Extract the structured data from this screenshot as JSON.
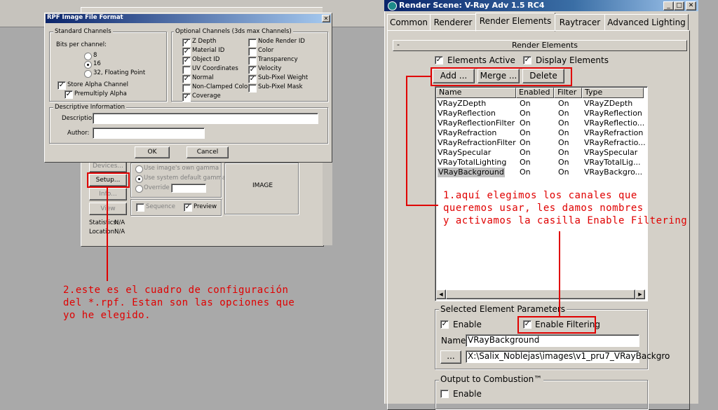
{
  "rpf_dialog": {
    "title": "RPF Image File Format",
    "standard_channels": {
      "title": "Standard Channels",
      "bits_label": "Bits per channel:",
      "opt8": "8",
      "opt16": "16",
      "opt32": "32, Floating Point",
      "store_alpha": "Store Alpha Channel",
      "premultiply": "Premultiply Alpha"
    },
    "optional_channels": {
      "title": "Optional Channels (3ds max Channels)",
      "col1": [
        "Z Depth",
        "Material ID",
        "Object ID",
        "UV Coordinates",
        "Normal",
        "Non-Clamped Color",
        "Coverage"
      ],
      "col1_checked": [
        true,
        true,
        true,
        false,
        true,
        false,
        true
      ],
      "col2": [
        "Node Render ID",
        "Color",
        "Transparency",
        "Velocity",
        "Sub-Pixel Weight",
        "Sub-Pixel Mask"
      ],
      "col2_checked": [
        false,
        false,
        false,
        true,
        true,
        false
      ]
    },
    "descriptive": {
      "title": "Descriptive Information",
      "description_label": "Description:",
      "author_label": "Author:"
    },
    "ok": "OK",
    "cancel": "Cancel"
  },
  "bg_dialog": {
    "devices": "Devices...",
    "setup": "Setup...",
    "info": "Info...",
    "view": "View",
    "use_own_gamma": "Use image's own gamma",
    "use_system_gamma": "Use system default gamma",
    "override": "Override",
    "sequence": "Sequence",
    "preview": "Preview",
    "image": "IMAGE",
    "statistics_label": "Statistics:",
    "statistics_value": "N/A",
    "location_label": "Location:",
    "location_value": "N/A"
  },
  "render_scene": {
    "title": "Render Scene: V-Ray Adv 1.5 RC4",
    "tabs": [
      "Common",
      "Renderer",
      "Render Elements",
      "Raytracer",
      "Advanced Lighting"
    ],
    "rollout_title": "Render Elements",
    "rollout_minus": "-",
    "elements_active": "Elements Active",
    "display_elements": "Display Elements",
    "add": "Add ...",
    "merge": "Merge ...",
    "delete": "Delete",
    "columns": [
      "Name",
      "Enabled",
      "Filter",
      "Type"
    ],
    "rows": [
      {
        "name": "VRayZDepth",
        "enabled": "On",
        "filter": "On",
        "type": "VRayZDepth"
      },
      {
        "name": "VRayReflection",
        "enabled": "On",
        "filter": "On",
        "type": "VRayReflection"
      },
      {
        "name": "VRayReflectionFilter",
        "enabled": "On",
        "filter": "On",
        "type": "VRayReflectio..."
      },
      {
        "name": "VRayRefraction",
        "enabled": "On",
        "filter": "On",
        "type": "VRayRefraction"
      },
      {
        "name": "VRayRefractionFilter",
        "enabled": "On",
        "filter": "On",
        "type": "VRayRefractio..."
      },
      {
        "name": "VRaySpecular",
        "enabled": "On",
        "filter": "On",
        "type": "VRaySpecular"
      },
      {
        "name": "VRayTotalLighting",
        "enabled": "On",
        "filter": "On",
        "type": "VRayTotalLig..."
      },
      {
        "name": "VRayBackground",
        "enabled": "On",
        "filter": "On",
        "type": "VRayBackgro..."
      }
    ],
    "selected_params_title": "Selected Element Parameters",
    "enable": "Enable",
    "enable_filtering": "Enable Filtering",
    "name_label": "Name:",
    "name_value": "VRayBackground",
    "browse": "...",
    "path_value": "X:\\Salix_Noblejas\\images\\v1_pru7_VRayBackgro",
    "combustion_title": "Output to Combustion™",
    "combustion_enable": "Enable"
  },
  "annotations": {
    "note1": "1.aquí elegimos los canales que\nqueremos usar, les damos nombres\ny activamos la casilla Enable Filtering",
    "note2": "2.este es el cuadro de configuración\ndel *.rpf. Estan son las opciones que\nyo he elegido."
  },
  "colors": {
    "annotation": "#e00000",
    "titlebar": "#0a246a",
    "window": "#d4d0c8"
  }
}
